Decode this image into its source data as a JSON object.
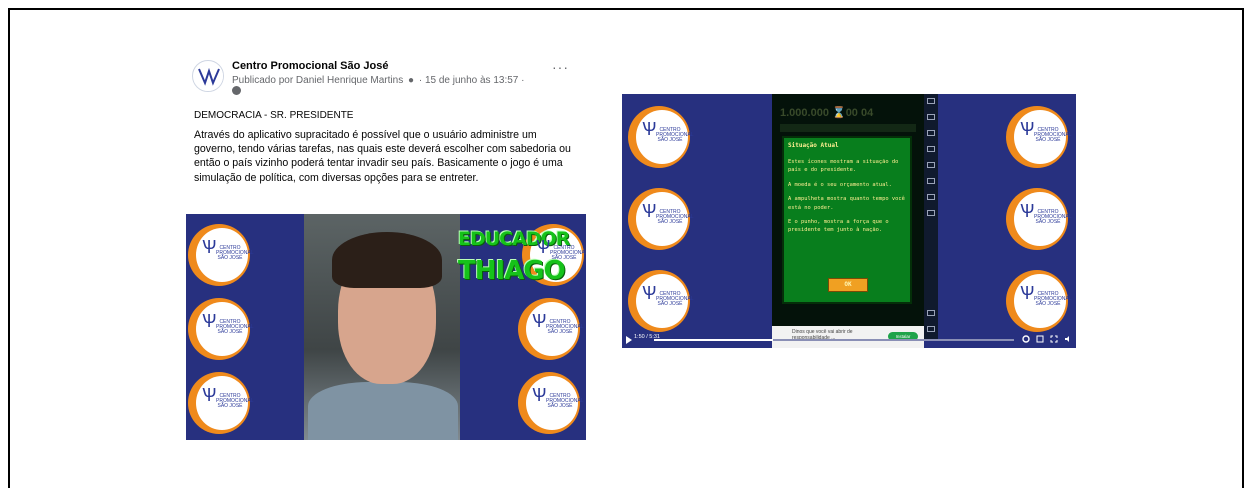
{
  "post": {
    "page_name": "Centro Promocional São José",
    "byline": "Publicado por Daniel Henrique Martins",
    "date": "15 de junho às 13:57",
    "more": "···",
    "title": "DEMOCRACIA - SR. PRESIDENTE",
    "body": "Através do aplicativo supracitado é possível que o usuário administre um governo, tendo várias tarefas, nas quais este deverá escolher com sabedoria ou então o país vizinho poderá tentar invadir seu país. Basicamente o jogo é uma simulação de política, com diversas opções para se entreter."
  },
  "video1": {
    "overlay_line1": "EDUCADOR",
    "overlay_line2": "THIAGO",
    "logo_text": "CENTRO PROMOCIONAL SÃO JOSÉ"
  },
  "video2": {
    "stats": "1.000.000 ⌛00 04",
    "dialog_title": "Situação Atual",
    "dialog_lines": [
      "Estes ícones mostram a situação do país e do presidente.",
      "A moeda é o seu orçamento atual.",
      "A ampulheta mostra quanto tempo você está no poder.",
      "E o punho, mostra a força que o presidente tem junto à nação."
    ],
    "ok_label": "OK",
    "time": "1:50 / 5:31",
    "ad_text": "Dinos que você vai abrir de responsabilidade ...",
    "ad_button": "Instalar",
    "progress": 0.33
  }
}
